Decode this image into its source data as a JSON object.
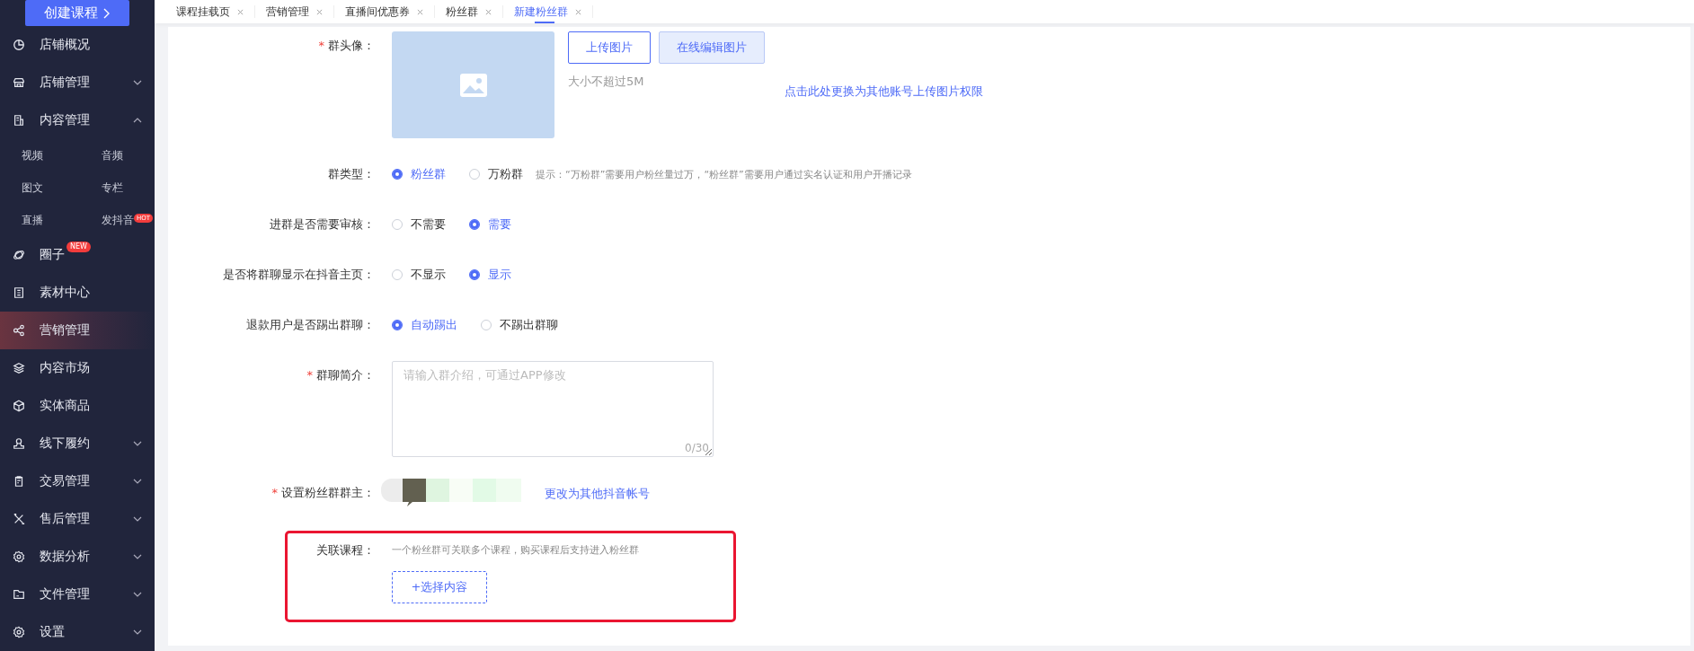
{
  "sidebar": {
    "create_button": "创建课程",
    "items": [
      {
        "label": "店铺概况",
        "selected": false
      },
      {
        "label": "店铺管理",
        "selected": false,
        "expanded": false
      },
      {
        "label": "内容管理",
        "selected": false,
        "expanded": true,
        "children": [
          {
            "label": "视频"
          },
          {
            "label": "音频"
          },
          {
            "label": "图文"
          },
          {
            "label": "专栏"
          },
          {
            "label": "直播"
          },
          {
            "label": "发抖音",
            "badge": "HOT"
          }
        ]
      },
      {
        "label": "圈子",
        "selected": false,
        "badge": "NEW"
      },
      {
        "label": "素材中心",
        "selected": false
      },
      {
        "label": "营销管理",
        "selected": true
      },
      {
        "label": "内容市场",
        "selected": false
      },
      {
        "label": "实体商品",
        "selected": false
      },
      {
        "label": "线下履约",
        "selected": false,
        "expanded": false
      },
      {
        "label": "交易管理",
        "selected": false,
        "expanded": false
      },
      {
        "label": "售后管理",
        "selected": false,
        "expanded": false
      },
      {
        "label": "数据分析",
        "selected": false,
        "expanded": false
      },
      {
        "label": "文件管理",
        "selected": false,
        "expanded": false
      },
      {
        "label": "设置",
        "selected": false,
        "expanded": false
      }
    ]
  },
  "tabs": [
    {
      "label": "课程挂载页",
      "selected": false
    },
    {
      "label": "营销管理",
      "selected": false
    },
    {
      "label": "直播间优惠券",
      "selected": false
    },
    {
      "label": "粉丝群",
      "selected": false
    },
    {
      "label": "新建粉丝群",
      "selected": true
    }
  ],
  "form": {
    "avatar": {
      "required_mark": "*",
      "label": "群头像：",
      "upload_button": "上传图片",
      "edit_button": "在线编辑图片",
      "size_hint": "大小不超过5M",
      "permission_link": "点击此处更换为其他账号上传图片权限"
    },
    "radio_groups": [
      {
        "label": "群类型：",
        "options": [
          {
            "label": "粉丝群",
            "selected": true
          },
          {
            "label": "万粉群",
            "selected": false
          }
        ],
        "hint": "提示：“万粉群”需要用户粉丝量过万，“粉丝群”需要用户通过实名认证和用户开播记录"
      },
      {
        "label": "进群是否需要审核：",
        "options": [
          {
            "label": "不需要",
            "selected": false
          },
          {
            "label": "需要",
            "selected": true
          }
        ]
      },
      {
        "label": "是否将群聊显示在抖音主页：",
        "options": [
          {
            "label": "不显示",
            "selected": false
          },
          {
            "label": "显示",
            "selected": true
          }
        ]
      },
      {
        "label": "退款用户是否踢出群聊：",
        "options": [
          {
            "label": "自动踢出",
            "selected": true
          },
          {
            "label": "不踢出群聊",
            "selected": false
          }
        ]
      }
    ],
    "intro": {
      "required_mark": "*",
      "label": "群聊简介：",
      "placeholder": "请输入群介绍，可通过APP修改",
      "counter": "0/30"
    },
    "owner": {
      "required_mark": "*",
      "label": "设置粉丝群群主：",
      "change_link": "更改为其他抖音帐号"
    },
    "course": {
      "label": "关联课程：",
      "hint": "一个粉丝群可关联多个课程，购买课程后支持进入粉丝群",
      "select_button": "+选择内容",
      "highlighted": true
    }
  }
}
